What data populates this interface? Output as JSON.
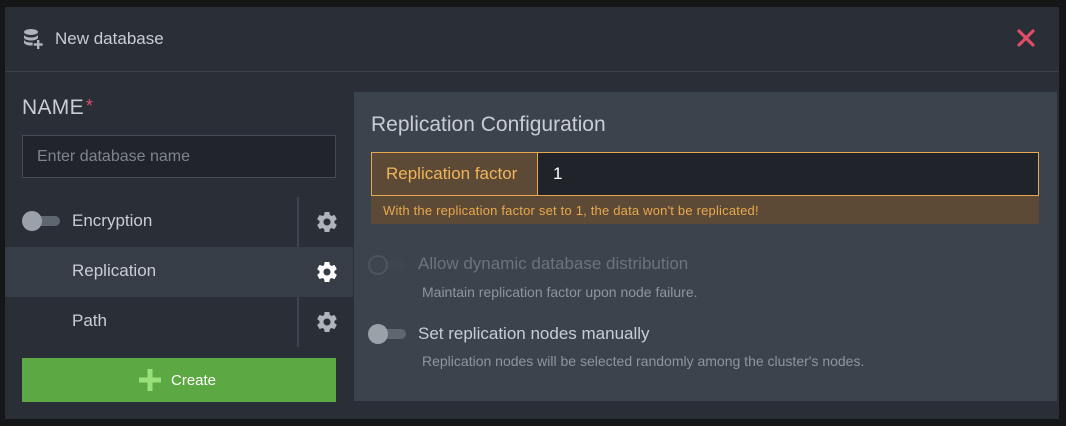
{
  "header": {
    "title": "New database",
    "icon": "database-add-icon",
    "close_icon": "close-icon",
    "close_color": "#e04d66"
  },
  "form": {
    "name_label": "NAME",
    "required_mark": "*",
    "name_placeholder": "Enter database name",
    "name_value": ""
  },
  "sidebar": {
    "items": [
      {
        "label": "Encryption",
        "has_toggle": true,
        "toggle_on": false,
        "active": false,
        "icon": "gear-icon"
      },
      {
        "label": "Replication",
        "has_toggle": false,
        "active": true,
        "icon": "gear-icon"
      },
      {
        "label": "Path",
        "has_toggle": false,
        "active": false,
        "icon": "gear-icon"
      }
    ]
  },
  "create_button": {
    "label": "Create",
    "icon": "plus-icon",
    "color": "#5ca943"
  },
  "replication": {
    "section_title": "Replication Configuration",
    "factor_label": "Replication factor",
    "factor_value": "1",
    "warning": "With the replication factor set to 1, the data won't be replicated!",
    "warning_color": "#e8a94e",
    "options": [
      {
        "title": "Allow dynamic database distribution",
        "description": "Maintain replication factor upon node failure.",
        "enabled": false,
        "toggle_on": false
      },
      {
        "title": "Set replication nodes manually",
        "description": "Replication nodes will be selected randomly among the cluster's nodes.",
        "enabled": true,
        "toggle_on": false
      }
    ]
  }
}
